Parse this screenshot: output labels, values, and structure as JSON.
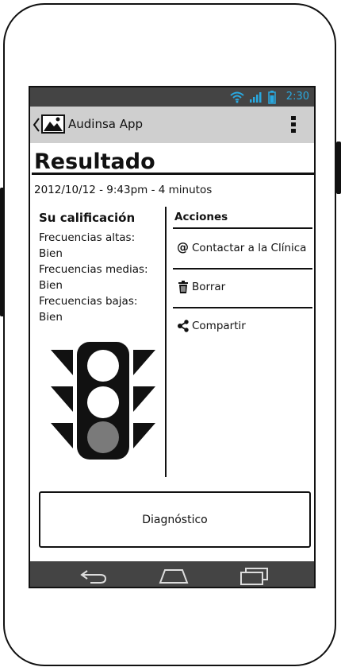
{
  "status_bar": {
    "time": "2:30"
  },
  "app_bar": {
    "title": "Audinsa App"
  },
  "page": {
    "title": "Resultado",
    "datetime": "2012/10/12 - 9:43pm - 4 minutos"
  },
  "rating": {
    "heading": "Su calificación",
    "lines": [
      "Frecuencias altas:",
      "Bien",
      "Frecuencias medias:",
      "Bien",
      "Frecuencias bajas:",
      "Bien"
    ]
  },
  "actions": {
    "heading": "Acciones",
    "items": [
      {
        "label": "Contactar a la Clínica",
        "icon": "at-icon"
      },
      {
        "label": "Borrar",
        "icon": "trash-icon"
      },
      {
        "label": "Compartir",
        "icon": "share-icon"
      }
    ]
  },
  "diagnosis_button": {
    "label": "Diagnóstico"
  },
  "colors": {
    "status_time": "#29a9e0",
    "status_bar": "#444444",
    "app_bar": "#cfcfcf",
    "light_off": "#7a7a7a"
  }
}
